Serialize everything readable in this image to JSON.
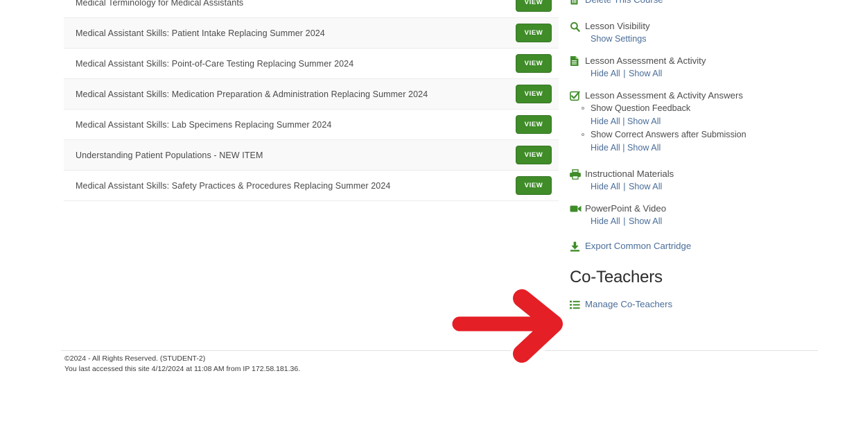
{
  "colors": {
    "link_blue": "#4a6d99",
    "icon_green": "#3f8c29",
    "button_green": "#3f8c29",
    "arrow_red": "#e41f26",
    "row_alt": "#f9f9f9",
    "text_gray": "#4a4a4a"
  },
  "lesson_list": {
    "view_label": "VIEW",
    "rows": [
      {
        "title": "Medical Terminology for Medical Assistants",
        "alt": false
      },
      {
        "title": "Medical Assistant Skills: Patient Intake Replacing Summer 2024",
        "alt": true
      },
      {
        "title": "Medical Assistant Skills: Point-of-Care Testing Replacing Summer 2024",
        "alt": false
      },
      {
        "title": "Medical Assistant Skills: Medication Preparation & Administration Replacing Summer 2024",
        "alt": true
      },
      {
        "title": "Medical Assistant Skills: Lab Specimens Replacing Summer 2024",
        "alt": false
      },
      {
        "title": "Understanding Patient Populations - NEW ITEM",
        "alt": true
      },
      {
        "title": "Medical Assistant Skills: Safety Practices & Procedures Replacing Summer 2024",
        "alt": false
      }
    ]
  },
  "sidebar": {
    "delete_course": {
      "icon": "trash-icon",
      "label": "Delete This Course"
    },
    "lesson_visibility": {
      "icon": "magnifier-icon",
      "label": "Lesson Visibility",
      "show_settings": "Show Settings"
    },
    "lesson_assessment_activity": {
      "icon": "document-icon",
      "label": "Lesson Assessment & Activity",
      "hide_all": "Hide All",
      "separator": "|",
      "show_all": "Show All"
    },
    "lesson_assessment_answers": {
      "icon": "checkbox-check-icon",
      "label": "Lesson Assessment & Activity Answers",
      "items": [
        {
          "label": "Show Question Feedback",
          "hide_all": "Hide All",
          "separator": "|",
          "show_all": "Show All"
        },
        {
          "label": "Show Correct Answers after Submission",
          "hide_all": "Hide All",
          "separator": "|",
          "show_all": "Show All"
        }
      ]
    },
    "instructional_materials": {
      "icon": "printer-icon",
      "label": "Instructional Materials",
      "hide_all": "Hide All",
      "separator": "|",
      "show_all": "Show All"
    },
    "powerpoint_video": {
      "icon": "video-camera-icon",
      "label": "PowerPoint & Video",
      "hide_all": "Hide All",
      "separator": "|",
      "show_all": "Show All"
    },
    "export_cartridge": {
      "icon": "download-icon",
      "label": "Export Common Cartridge"
    },
    "coteachers_heading": "Co-Teachers",
    "manage_coteachers": {
      "icon": "list-icon",
      "label": "Manage Co-Teachers"
    }
  },
  "footer": {
    "copyright": "©2024 - All Rights Reserved. (STUDENT-2)",
    "last_access": "You last accessed this site 4/12/2024 at 11:08 AM from IP 172.58.181.36."
  },
  "annotation": {
    "arrow": "right-arrow-annotation",
    "points_at": "Manage Co-Teachers"
  }
}
